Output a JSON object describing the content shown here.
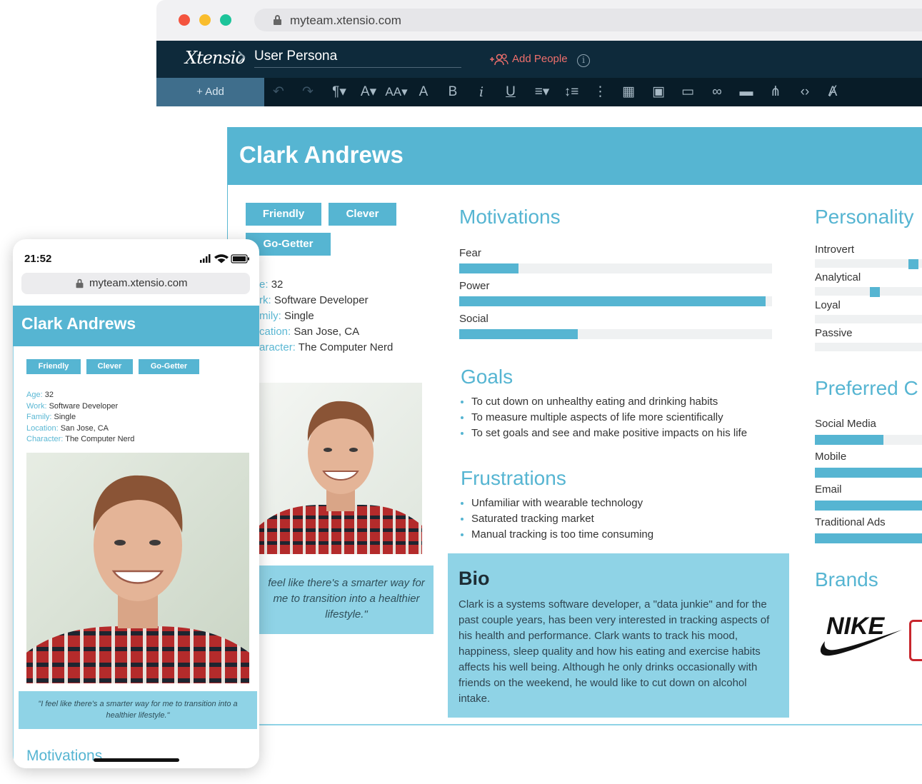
{
  "browser": {
    "url": "myteam.xtensio.com",
    "logo": "Xtensio",
    "doc_title": "User Persona",
    "add_people_label": "Add People",
    "add_button_label": "+ Add",
    "toolbar_icons": [
      "undo-icon",
      "redo-icon",
      "paragraph-icon",
      "font-color-icon",
      "font-size-icon",
      "text-highlight-icon",
      "bold-icon",
      "italic-icon",
      "underline-icon",
      "align-icon",
      "line-height-icon",
      "more-icon",
      "table-icon",
      "image-icon",
      "video-icon",
      "link-icon",
      "button-icon",
      "share-icon",
      "embed-code-icon",
      "clear-format-icon"
    ]
  },
  "persona": {
    "name": "Clark Andrews",
    "tags": [
      "Friendly",
      "Clever",
      "Go-Getter"
    ],
    "info": [
      {
        "key": "Age",
        "value": "32"
      },
      {
        "key": "Work",
        "value": "Software Developer"
      },
      {
        "key": "Family",
        "value": "Single"
      },
      {
        "key": "Location",
        "value": "San Jose, CA"
      },
      {
        "key": "Character",
        "value": "The Computer Nerd"
      }
    ],
    "desktop_info_keys": [
      "e:",
      "rk:",
      "mily:",
      "cation:",
      "aracter:"
    ],
    "quote_desktop_lines": [
      "feel like there's a smarter way for",
      "me to transition into a healthier",
      "lifestyle.\""
    ],
    "quote_mobile": "\"I feel like there's a smarter way for me to transition into a healthier lifestyle.\"",
    "motivations": {
      "title": "Motivations",
      "items": [
        {
          "label": "Fear",
          "value": 0.19
        },
        {
          "label": "Power",
          "value": 0.98
        },
        {
          "label": "Social",
          "value": 0.38
        }
      ]
    },
    "goals": {
      "title": "Goals",
      "items": [
        "To cut down on unhealthy eating and drinking habits",
        "To measure multiple aspects of life more scientifically",
        "To set goals and see and make positive impacts on his life"
      ]
    },
    "frustrations": {
      "title": "Frustrations",
      "items": [
        "Unfamiliar with wearable technology",
        "Saturated tracking market",
        "Manual tracking is too time consuming"
      ]
    },
    "bio": {
      "title": "Bio",
      "text": "Clark is a systems software developer, a \"data junkie\" and for the past couple years, has been very interested in tracking aspects of his health and performance. Clark wants to track his mood, happiness, sleep quality and how his eating and exercise habits affects his well being. Although he only drinks occasionally with friends on the weekend, he would like to cut down on alcohol intake."
    },
    "personality": {
      "title": "Personality",
      "items": [
        {
          "label": "Introvert",
          "value": 0.9
        },
        {
          "label": "Analytical",
          "value": 0.55
        },
        {
          "label": "Loyal",
          "value": null
        },
        {
          "label": "Passive",
          "value": null
        }
      ]
    },
    "preferred_channels": {
      "title": "Preferred C",
      "items": [
        {
          "label": "Social Media",
          "value": 0.6
        },
        {
          "label": "Mobile",
          "value": 1.0
        },
        {
          "label": "Email",
          "value": 1.0
        },
        {
          "label": "Traditional Ads",
          "value": 1.0
        }
      ]
    },
    "brands": {
      "title": "Brands",
      "items": [
        "NIKE"
      ]
    }
  },
  "mobile": {
    "time": "21:52",
    "url": "myteam.xtensio.com",
    "next_section": "Motivations"
  },
  "colors": {
    "accent": "#56b5d2",
    "accent_light": "#8fd3e6",
    "navbar": "#0e2a3b",
    "toolbar": "#081c28",
    "add_people": "#ef6f6c"
  }
}
